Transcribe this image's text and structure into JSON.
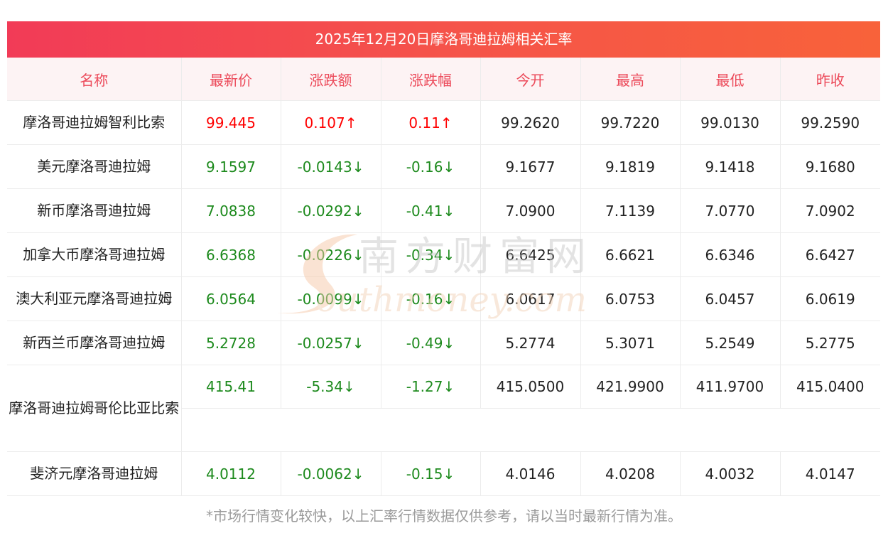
{
  "title": "2025年12月20日摩洛哥迪拉姆相关汇率",
  "headers": [
    "名称",
    "最新价",
    "涨跌额",
    "涨跌幅",
    "今开",
    "最高",
    "最低",
    "昨收"
  ],
  "rows": [
    {
      "name": "摩洛哥迪拉姆智利比索",
      "latest": "99.445",
      "change": "0.107↑",
      "pct": "0.11↑",
      "open": "99.2620",
      "high": "99.7220",
      "low": "99.0130",
      "prev": "99.2590",
      "dir": "up"
    },
    {
      "name": "美元摩洛哥迪拉姆",
      "latest": "9.1597",
      "change": "-0.0143↓",
      "pct": "-0.16↓",
      "open": "9.1677",
      "high": "9.1819",
      "low": "9.1418",
      "prev": "9.1680",
      "dir": "down"
    },
    {
      "name": "新币摩洛哥迪拉姆",
      "latest": "7.0838",
      "change": "-0.0292↓",
      "pct": "-0.41↓",
      "open": "7.0900",
      "high": "7.1139",
      "low": "7.0770",
      "prev": "7.0902",
      "dir": "down"
    },
    {
      "name": "加拿大币摩洛哥迪拉姆",
      "latest": "6.6368",
      "change": "-0.0226↓",
      "pct": "-0.34↓",
      "open": "6.6425",
      "high": "6.6621",
      "low": "6.6346",
      "prev": "6.6427",
      "dir": "down"
    },
    {
      "name": "澳大利亚元摩洛哥迪拉姆",
      "latest": "6.0564",
      "change": "-0.0099↓",
      "pct": "-0.16↓",
      "open": "6.0617",
      "high": "6.0753",
      "low": "6.0457",
      "prev": "6.0619",
      "dir": "down"
    },
    {
      "name": "新西兰币摩洛哥迪拉姆",
      "latest": "5.2728",
      "change": "-0.0257↓",
      "pct": "-0.49↓",
      "open": "5.2774",
      "high": "5.3071",
      "low": "5.2549",
      "prev": "5.2775",
      "dir": "down"
    },
    {
      "name": "摩洛哥迪拉姆哥伦比亚比索",
      "latest": "415.41",
      "change": "-5.34↓",
      "pct": "-1.27↓",
      "open": "415.0500",
      "high": "421.9900",
      "low": "411.9700",
      "prev": "415.0400",
      "dir": "down",
      "wrap": true
    },
    {
      "name": "斐济元摩洛哥迪拉姆",
      "latest": "4.0112",
      "change": "-0.0062↓",
      "pct": "-0.15↓",
      "open": "4.0146",
      "high": "4.0208",
      "low": "4.0032",
      "prev": "4.0147",
      "dir": "down"
    }
  ],
  "watermark": {
    "cn": "南方财富网",
    "en": "outhmoney.com"
  },
  "footer": "*市场行情变化较快，以上汇率行情数据仅供参考，请以当时最新行情为准。",
  "colors": {
    "up": "#ff0000",
    "down": "#1d8a1d",
    "header_text": "#ec4a5a",
    "title_bg_start": "#f23b57",
    "title_bg_end": "#f8623a"
  }
}
